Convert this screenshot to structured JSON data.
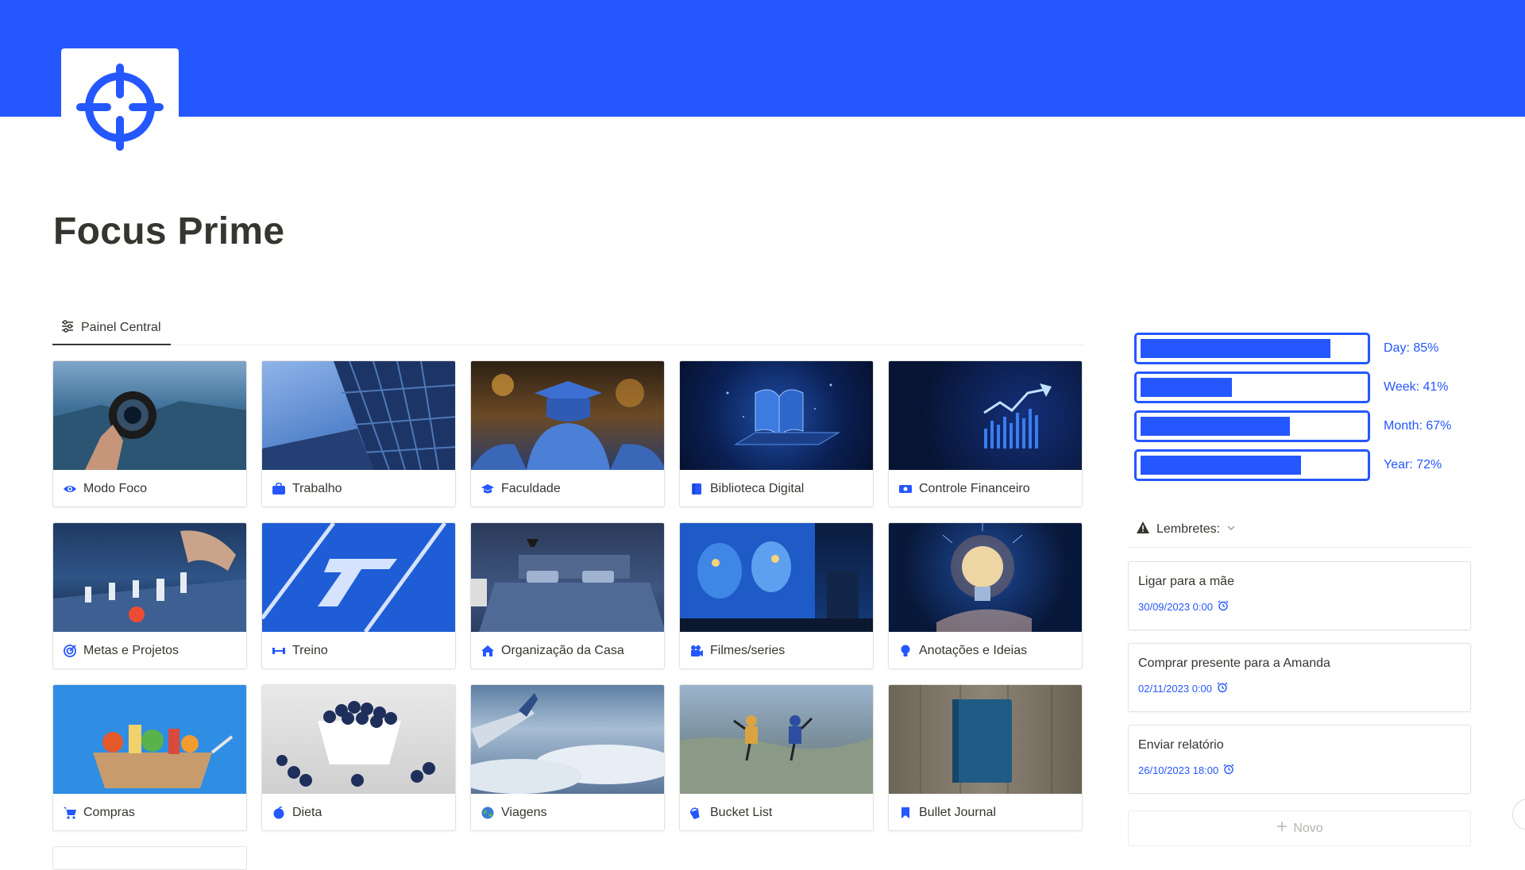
{
  "page": {
    "title": "Focus Prime",
    "accent": "#2557ff"
  },
  "tabs": [
    {
      "label": "Painel Central",
      "icon": "sliders-icon"
    }
  ],
  "cards": [
    {
      "label": "Modo Foco",
      "icon": "eye-icon"
    },
    {
      "label": "Trabalho",
      "icon": "briefcase-icon"
    },
    {
      "label": "Faculdade",
      "icon": "graduation-cap-icon"
    },
    {
      "label": "Biblioteca Digital",
      "icon": "book-icon"
    },
    {
      "label": "Controle Financeiro",
      "icon": "money-icon"
    },
    {
      "label": "Metas e Projetos",
      "icon": "target-icon"
    },
    {
      "label": "Treino",
      "icon": "dumbbell-icon"
    },
    {
      "label": "Organização da Casa",
      "icon": "house-icon"
    },
    {
      "label": "Filmes/series",
      "icon": "film-camera-icon"
    },
    {
      "label": "Anotações e Ideias",
      "icon": "lightbulb-icon"
    },
    {
      "label": "Compras",
      "icon": "cart-icon"
    },
    {
      "label": "Dieta",
      "icon": "apple-icon"
    },
    {
      "label": "Viagens",
      "icon": "globe-icon"
    },
    {
      "label": "Bucket List",
      "icon": "bucket-icon"
    },
    {
      "label": "Bullet Journal",
      "icon": "bookmark-icon"
    }
  ],
  "progress": [
    {
      "label": "Day: 85%",
      "value": 0.85
    },
    {
      "label": "Week: 41%",
      "value": 0.41
    },
    {
      "label": "Month: 67%",
      "value": 0.67
    },
    {
      "label": "Year: 72%",
      "value": 0.72
    }
  ],
  "reminders": {
    "header": "Lembretes:",
    "items": [
      {
        "title": "Ligar para a mãe",
        "date": "30/09/2023 0:00"
      },
      {
        "title": "Comprar presente para a Amanda",
        "date": "02/11/2023 0:00"
      },
      {
        "title": "Enviar relatório",
        "date": "26/10/2023 18:00"
      }
    ],
    "new_label": "Novo"
  }
}
